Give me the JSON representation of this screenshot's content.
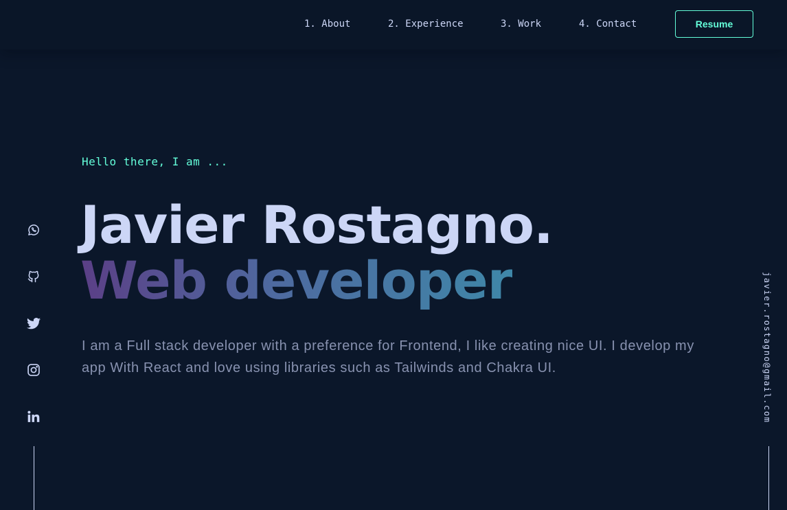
{
  "nav": {
    "items": [
      {
        "label": "1. About"
      },
      {
        "label": "2. Experience"
      },
      {
        "label": "3. Work"
      },
      {
        "label": "4. Contact"
      }
    ],
    "resume_label": "Resume"
  },
  "hero": {
    "greeting": "Hello there, I am ...",
    "name": "Javier Rostagno.",
    "role": "Web developer",
    "bio": "I am a Full stack developer with a preference for Frontend, I like creating nice UI. I develop my app With React and love using libraries such as Tailwinds and Chakra UI."
  },
  "social": [
    {
      "icon": "whatsapp-icon"
    },
    {
      "icon": "github-icon"
    },
    {
      "icon": "twitter-icon"
    },
    {
      "icon": "instagram-icon"
    },
    {
      "icon": "linkedin-icon"
    }
  ],
  "email": "javier.rostagno@gmail.com",
  "colors": {
    "background": "#0b172a",
    "accent": "#64ffda",
    "heading": "#ccd6f6",
    "body_text": "#8892b0",
    "gradient_start": "#5b3f86",
    "gradient_end": "#3f87a8"
  }
}
